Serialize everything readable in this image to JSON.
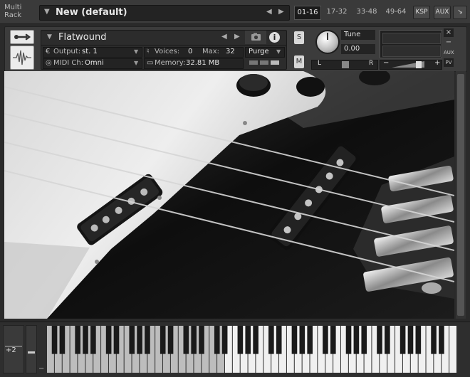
{
  "topbar": {
    "multi_rack_label_1": "Multi",
    "multi_rack_label_2": "Rack",
    "rack_name": "New (default)",
    "page_tabs": [
      "01-16",
      "17-32",
      "33-48",
      "49-64"
    ],
    "active_tab": "01-16",
    "buttons": {
      "ksp": "KSP",
      "aux": "AUX"
    }
  },
  "instrument": {
    "name": "Flatwound",
    "output_label": "Output:",
    "output_value": "st. 1",
    "voices_label": "Voices:",
    "voices_value": "0",
    "max_label": "Max:",
    "max_value": "32",
    "purge_label": "Purge",
    "midi_label": "MIDI Ch:",
    "midi_value": "Omni",
    "memory_label": "Memory:",
    "memory_value": "32.81 MB",
    "solo_label": "S",
    "mute_label": "M",
    "tune_label": "Tune",
    "tune_value": "0.00",
    "pan_left": "L",
    "pan_right": "R",
    "vol_minus": "−",
    "vol_plus": "+",
    "side_close": "×",
    "side_min": "−",
    "side_aux": "AUX",
    "side_pv": "PV"
  },
  "keyboard": {
    "octave_label": "+2",
    "minus_label": "−"
  },
  "colors": {
    "bg": "#2a2a2a",
    "panel": "#3c3c3c",
    "field": "#232323",
    "accent": "#e8e8e8"
  }
}
